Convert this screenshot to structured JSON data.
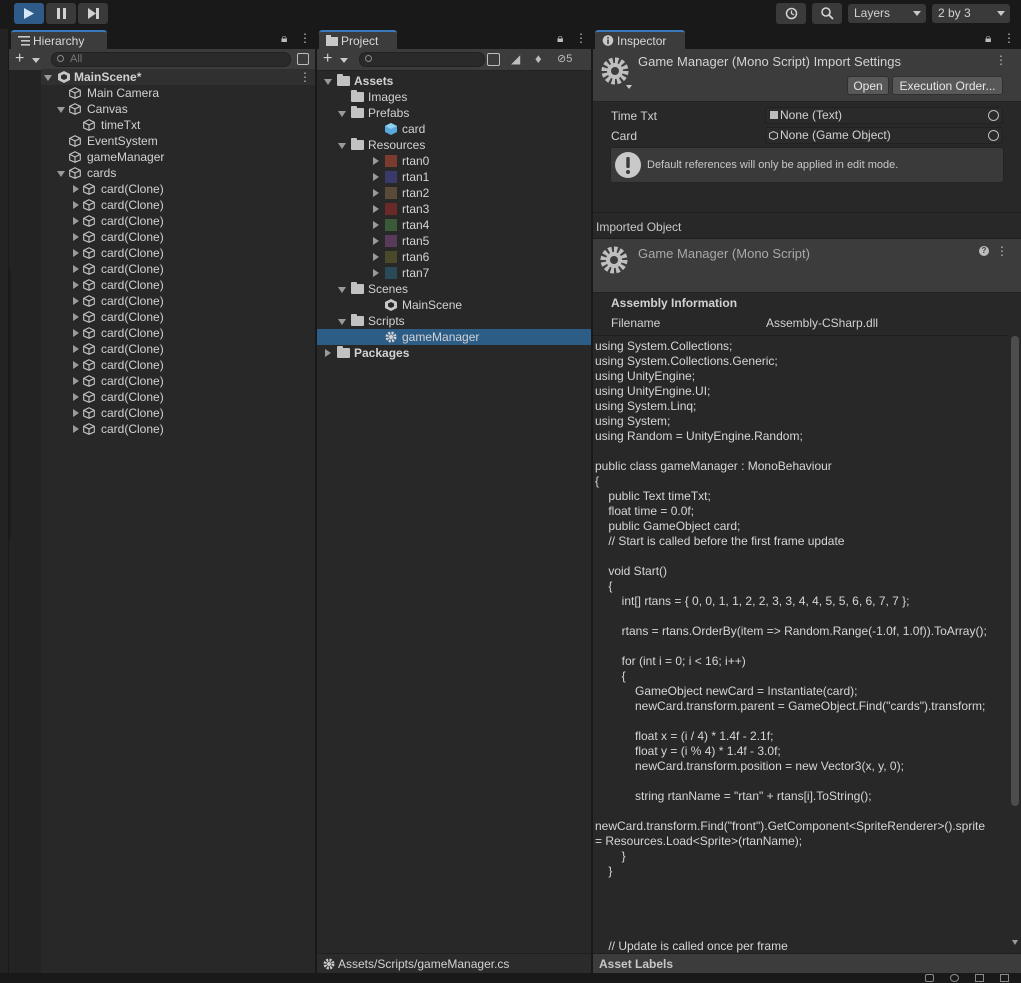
{
  "toolbar": {
    "play": "play-icon",
    "pause": "pause-icon",
    "step": "step-icon",
    "history": "history-icon",
    "search": "search-icon",
    "layers_label": "Layers",
    "layout_label": "2 by 3",
    "accent_color": "#2f5b8a"
  },
  "hierarchy": {
    "tab_label": "Hierarchy",
    "search_placeholder": "All",
    "scene": "MainScene*",
    "items": [
      {
        "label": "Main Camera"
      },
      {
        "label": "Canvas"
      },
      {
        "label": "timeTxt"
      },
      {
        "label": "EventSystem"
      },
      {
        "label": "gameManager"
      },
      {
        "label": "cards"
      }
    ],
    "clones": [
      "card(Clone)",
      "card(Clone)",
      "card(Clone)",
      "card(Clone)",
      "card(Clone)",
      "card(Clone)",
      "card(Clone)",
      "card(Clone)",
      "card(Clone)",
      "card(Clone)",
      "card(Clone)",
      "card(Clone)",
      "card(Clone)",
      "card(Clone)",
      "card(Clone)",
      "card(Clone)"
    ]
  },
  "project": {
    "tab_label": "Project",
    "hidden_count": "5",
    "tree": {
      "assets": "Assets",
      "images": "Images",
      "prefabs": "Prefabs",
      "card": "card",
      "resources": "Resources",
      "rtans": [
        "rtan0",
        "rtan1",
        "rtan2",
        "rtan3",
        "rtan4",
        "rtan5",
        "rtan6",
        "rtan7"
      ],
      "scenes": "Scenes",
      "mainscene": "MainScene",
      "scripts": "Scripts",
      "gamemanager": "gameManager",
      "packages": "Packages"
    },
    "status_path": "Assets/Scripts/gameManager.cs",
    "selection_color": "#2c5d87"
  },
  "inspector": {
    "tab_label": "Inspector",
    "title": "Game Manager (Mono Script) Import Settings",
    "open_label": "Open",
    "exec_label": "Execution Order...",
    "fields": [
      {
        "label": "Time Txt",
        "value": "None (Text)"
      },
      {
        "label": "Card",
        "value": "None (Game Object)"
      }
    ],
    "warning": "Default references will only be applied in edit mode.",
    "imported_object": "Imported Object",
    "script_title": "Game Manager (Mono Script)",
    "assembly_heading": "Assembly Information",
    "filename_label": "Filename",
    "filename_value": "Assembly-CSharp.dll",
    "code": "using System.Collections;\nusing System.Collections.Generic;\nusing UnityEngine;\nusing UnityEngine.UI;\nusing System.Linq;\nusing System;\nusing Random = UnityEngine.Random;\n\npublic class gameManager : MonoBehaviour\n{\n    public Text timeTxt;\n    float time = 0.0f;\n    public GameObject card;\n    // Start is called before the first frame update\n\n    void Start()\n    {\n        int[] rtans = { 0, 0, 1, 1, 2, 2, 3, 3, 4, 4, 5, 5, 6, 6, 7, 7 };\n\n        rtans = rtans.OrderBy(item => Random.Range(-1.0f, 1.0f)).ToArray();\n\n        for (int i = 0; i < 16; i++)\n        {\n            GameObject newCard = Instantiate(card);\n            newCard.transform.parent = GameObject.Find(\"cards\").transform;\n\n            float x = (i / 4) * 1.4f - 2.1f;\n            float y = (i % 4) * 1.4f - 3.0f;\n            newCard.transform.position = new Vector3(x, y, 0);\n\n            string rtanName = \"rtan\" + rtans[i].ToString();\n\nnewCard.transform.Find(\"front\").GetComponent<SpriteRenderer>().sprite\n= Resources.Load<Sprite>(rtanName);\n        }\n    }\n\n\n\n\n    // Update is called once per frame",
    "asset_labels": "Asset Labels"
  }
}
